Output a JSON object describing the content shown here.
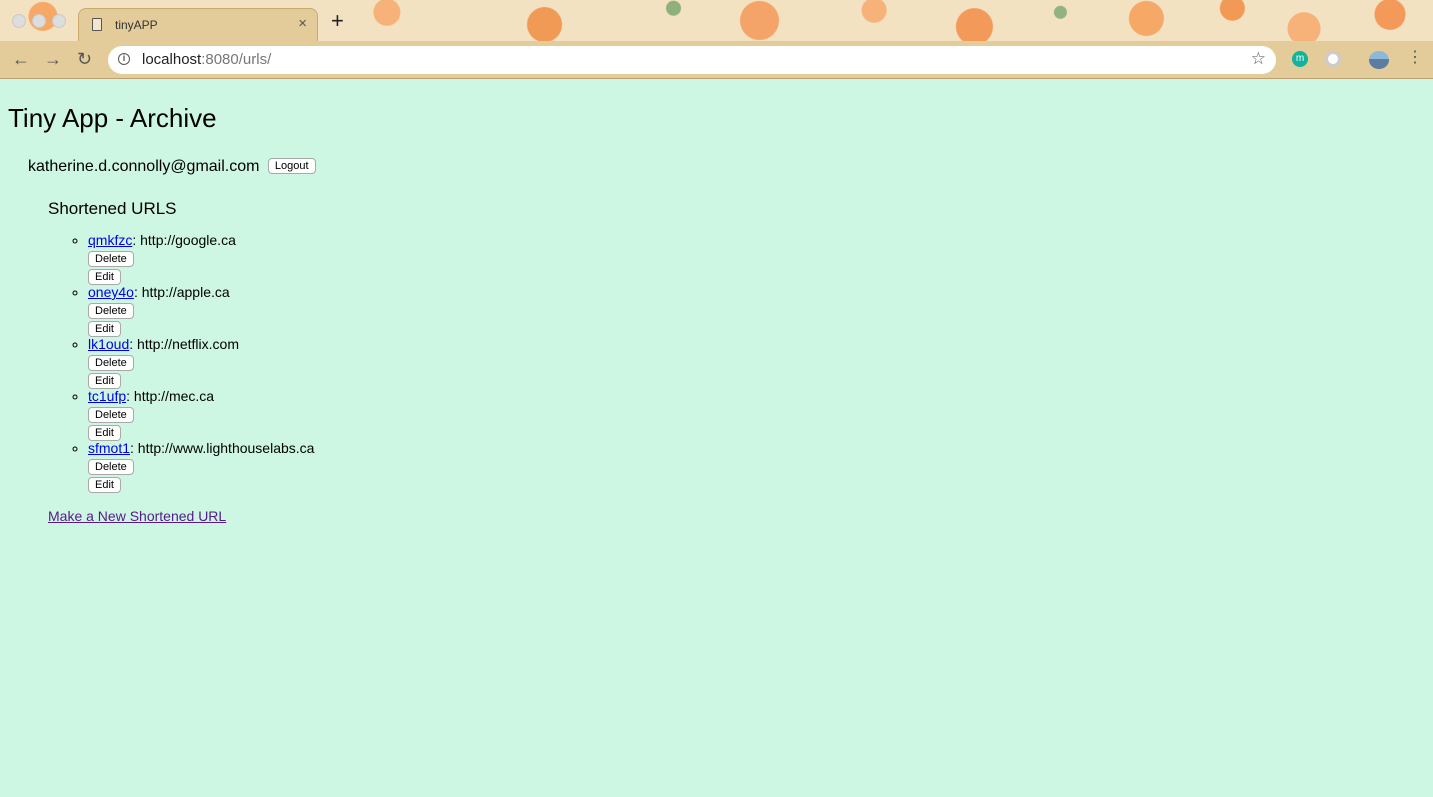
{
  "browser": {
    "tab_title": "tinyAPP",
    "tab_close": "×",
    "new_tab": "+",
    "url_host": "localhost",
    "url_rest": ":8080/urls/",
    "back_icon": "←",
    "forward_icon": "→",
    "reload_icon": "↻",
    "star_icon": "☆",
    "menu_icon": "⋮",
    "ext_label": "m"
  },
  "page": {
    "title": "Tiny App - Archive",
    "user_email": "katherine.d.connolly@gmail.com",
    "logout_label": "Logout",
    "section_title": "Shortened URLS",
    "delete_label": "Delete",
    "edit_label": "Edit",
    "new_link": "Make a New Shortened URL"
  },
  "urls": [
    {
      "short": "qmkfzc",
      "long": ": http://google.ca"
    },
    {
      "short": "oney4o",
      "long": ": http://apple.ca"
    },
    {
      "short": "lk1oud",
      "long": ": http://netflix.com"
    },
    {
      "short": "tc1ufp",
      "long": ": http://mec.ca"
    },
    {
      "short": "sfmot1",
      "long": ": http://www.lighthouselabs.ca"
    }
  ]
}
